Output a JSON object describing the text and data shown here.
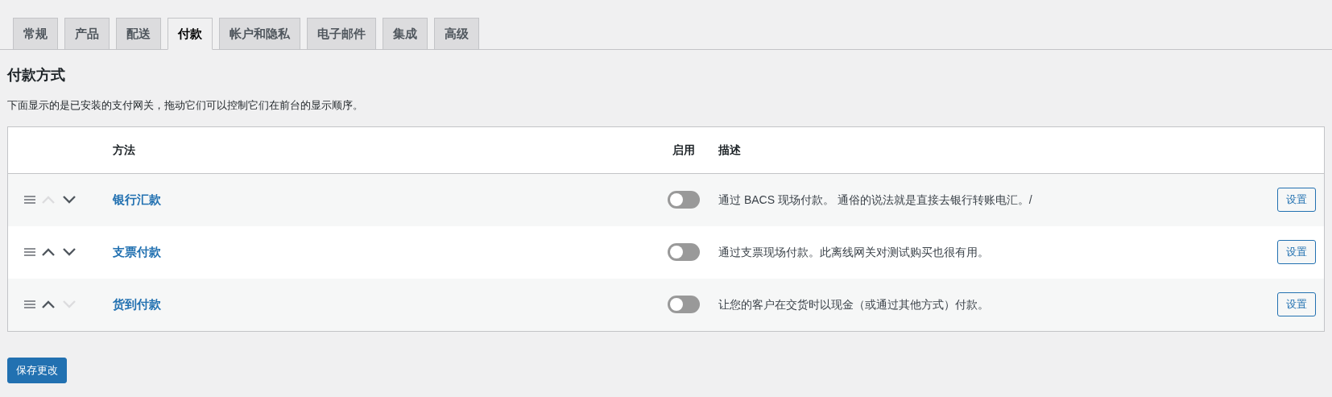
{
  "tabs": [
    {
      "label": "常规",
      "selected": false
    },
    {
      "label": "产品",
      "selected": false
    },
    {
      "label": "配送",
      "selected": false
    },
    {
      "label": "付款",
      "selected": true
    },
    {
      "label": "帐户和隐私",
      "selected": false
    },
    {
      "label": "电子邮件",
      "selected": false
    },
    {
      "label": "集成",
      "selected": false
    },
    {
      "label": "高级",
      "selected": false
    }
  ],
  "heading": "付款方式",
  "description": "下面显示的是已安装的支付网关，拖动它们可以控制它们在前台的显示顺序。",
  "table": {
    "columns": [
      "方法",
      "启用",
      "描述"
    ],
    "rows": [
      {
        "method": "银行汇款",
        "up_disabled": true,
        "down_disabled": false,
        "enabled": false,
        "description": "通过 BACS 现场付款。 通俗的说法就是直接去银行转账电汇。/",
        "button": "设置"
      },
      {
        "method": "支票付款",
        "up_disabled": false,
        "down_disabled": false,
        "enabled": false,
        "description": "通过支票现场付款。此离线网关对测试购买也很有用。",
        "button": "设置"
      },
      {
        "method": "货到付款",
        "up_disabled": false,
        "down_disabled": true,
        "enabled": false,
        "description": "让您的客户在交货时以现金（或通过其他方式）付款。",
        "button": "设置"
      }
    ]
  },
  "save_button": "保存更改"
}
